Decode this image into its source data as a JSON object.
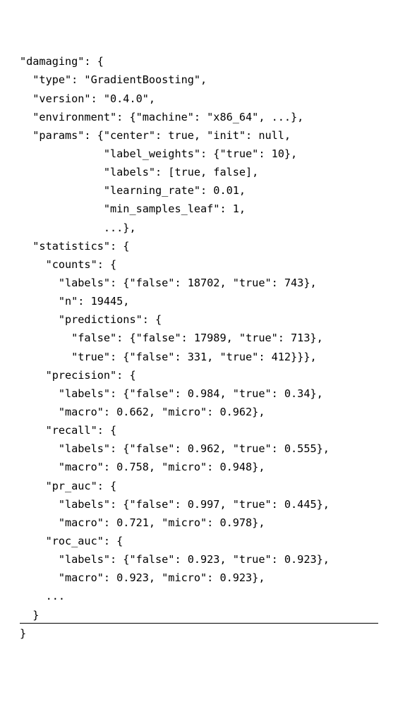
{
  "chart_data": {
    "type": "table",
    "title": "damaging",
    "model": {
      "type": "GradientBoosting",
      "version": "0.4.0",
      "environment": {
        "machine": "x86_64"
      },
      "params": {
        "center": true,
        "init": null,
        "label_weights": {
          "true": 10
        },
        "labels": [
          true,
          false
        ],
        "learning_rate": 0.01,
        "min_samples_leaf": 1
      }
    },
    "statistics": {
      "counts": {
        "labels": {
          "false": 18702,
          "true": 743
        },
        "n": 19445,
        "predictions": {
          "false": {
            "false": 17989,
            "true": 713
          },
          "true": {
            "false": 331,
            "true": 412
          }
        }
      },
      "precision": {
        "labels": {
          "false": 0.984,
          "true": 0.34
        },
        "macro": 0.662,
        "micro": 0.962
      },
      "recall": {
        "labels": {
          "false": 0.962,
          "true": 0.555
        },
        "macro": 0.758,
        "micro": 0.948
      },
      "pr_auc": {
        "labels": {
          "false": 0.997,
          "true": 0.445
        },
        "macro": 0.721,
        "micro": 0.978
      },
      "roc_auc": {
        "labels": {
          "false": 0.923,
          "true": 0.923
        },
        "macro": 0.923,
        "micro": 0.923
      }
    }
  },
  "lines": {
    "l01": "\"damaging\": {",
    "l02": "  \"type\": \"GradientBoosting\",",
    "l03": "  \"version\": \"0.4.0\",",
    "l04": "  \"environment\": {\"machine\": \"x86_64\", ...},",
    "l05": "  \"params\": {\"center\": true, \"init\": null,",
    "l06": "             \"label_weights\": {\"true\": 10},",
    "l07": "             \"labels\": [true, false],",
    "l08": "             \"learning_rate\": 0.01,",
    "l09": "             \"min_samples_leaf\": 1,",
    "l10": "             ...},",
    "l11": "  \"statistics\": {",
    "l12": "    \"counts\": {",
    "l13": "      \"labels\": {\"false\": 18702, \"true\": 743},",
    "l14": "      \"n\": 19445,",
    "l15": "      \"predictions\": {",
    "l16": "        \"false\": {\"false\": 17989, \"true\": 713},",
    "l17": "        \"true\": {\"false\": 331, \"true\": 412}}},",
    "l18": "    \"precision\": {",
    "l19": "      \"labels\": {\"false\": 0.984, \"true\": 0.34},",
    "l20": "      \"macro\": 0.662, \"micro\": 0.962},",
    "l21": "    \"recall\": {",
    "l22": "      \"labels\": {\"false\": 0.962, \"true\": 0.555},",
    "l23": "      \"macro\": 0.758, \"micro\": 0.948},",
    "l24": "    \"pr_auc\": {",
    "l25": "      \"labels\": {\"false\": 0.997, \"true\": 0.445},",
    "l26": "      \"macro\": 0.721, \"micro\": 0.978},",
    "l27": "    \"roc_auc\": {",
    "l28": "      \"labels\": {\"false\": 0.923, \"true\": 0.923},",
    "l29": "      \"macro\": 0.923, \"micro\": 0.923},",
    "l30": "    ...",
    "l31": "  }",
    "l32": "}"
  }
}
